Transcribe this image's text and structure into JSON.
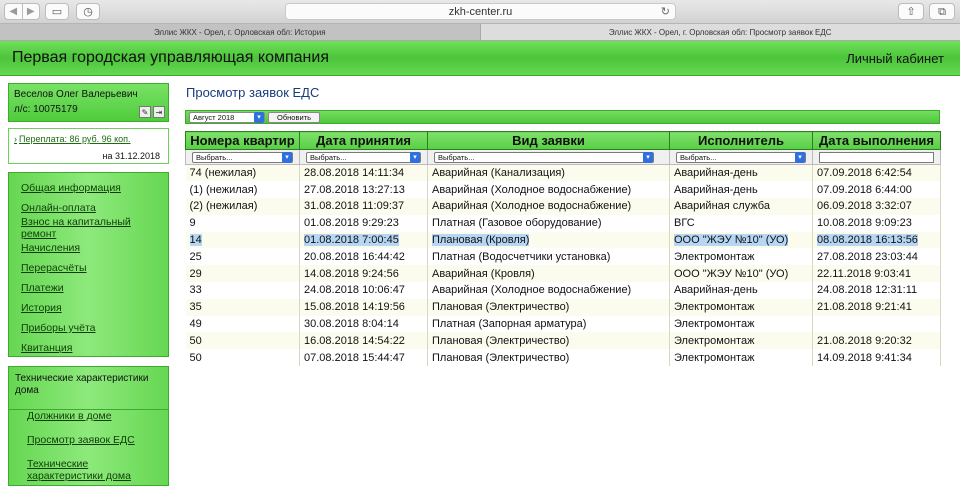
{
  "browser": {
    "url": "zkh-center.ru",
    "tabs": [
      "Эллис ЖКХ - Орел, г. Орловская обл: История",
      "Эллис ЖКХ - Орел, г. Орловская обл: Просмотр заявок ЕДС"
    ]
  },
  "header": {
    "company": "Первая городская управляющая компания",
    "cabinet": "Личный кабинет"
  },
  "user": {
    "name": "Веселов Олег Валерьевич",
    "account": "л/с: 10075179"
  },
  "balance": {
    "link": "Переплата: 86 руб. 96 коп.",
    "date": "на 31.12.2018"
  },
  "menu": [
    "Общая информация",
    "Онлайн-оплата",
    "Взнос на капитальный ремонт",
    "Начисления",
    "Перерасчёты",
    "Платежи",
    "История",
    "Приборы учёта",
    "Квитанция"
  ],
  "tech": {
    "title": "Технические характеристики дома",
    "links": [
      "Должники в доме",
      "Просмотр заявок ЕДС",
      "Технические характеристики дома"
    ]
  },
  "content": {
    "title": "Просмотр заявок ЕДС",
    "month": "Август 2018",
    "update_button": "Обновить"
  },
  "table": {
    "columns": [
      "Номера квартир",
      "Дата принятия",
      "Вид заявки",
      "Исполнитель",
      "Дата выполнения"
    ],
    "filter_placeholder": "Выбрать...",
    "rows": [
      [
        "74 (нежилая)",
        "28.08.2018 14:11:34",
        "Аварийная (Канализация)",
        "Аварийная-день",
        "07.09.2018 6:42:54"
      ],
      [
        "(1) (нежилая)",
        "27.08.2018 13:27:13",
        "Аварийная (Холодное водоснабжение)",
        "Аварийная-день",
        "07.09.2018 6:44:00"
      ],
      [
        "(2) (нежилая)",
        "31.08.2018 11:09:37",
        "Аварийная (Холодное водоснабжение)",
        "Аварийная служба",
        "06.09.2018 3:32:07"
      ],
      [
        "9",
        "01.08.2018 9:29:23",
        "Платная (Газовое оборудование)",
        "ВГС",
        "10.08.2018 9:09:23"
      ],
      [
        "14",
        "01.08.2018 7:00:45",
        "Плановая (Кровля)",
        "ООО \"ЖЭУ №10\" (УО)",
        "08.08.2018 16:13:56"
      ],
      [
        "25",
        "20.08.2018 16:44:42",
        "Платная (Водосчетчики установка)",
        "Электромонтаж",
        "27.08.2018 23:03:44"
      ],
      [
        "29",
        "14.08.2018 9:24:56",
        "Аварийная (Кровля)",
        "ООО \"ЖЭУ №10\" (УО)",
        "22.11.2018 9:03:41"
      ],
      [
        "33",
        "24.08.2018 10:06:47",
        "Аварийная (Холодное водоснабжение)",
        "Аварийная-день",
        "24.08.2018 12:31:11"
      ],
      [
        "35",
        "15.08.2018 14:19:56",
        "Плановая (Электричество)",
        "Электромонтаж",
        "21.08.2018 9:21:41"
      ],
      [
        "49",
        "30.08.2018 8:04:14",
        "Платная (Запорная арматура)",
        "Электромонтаж",
        ""
      ],
      [
        "50",
        "16.08.2018 14:54:22",
        "Плановая (Электричество)",
        "Электромонтаж",
        "21.08.2018 9:20:32"
      ],
      [
        "50",
        "07.08.2018 15:44:47",
        "Плановая (Электричество)",
        "Электромонтаж",
        "14.09.2018 9:41:34"
      ]
    ]
  }
}
